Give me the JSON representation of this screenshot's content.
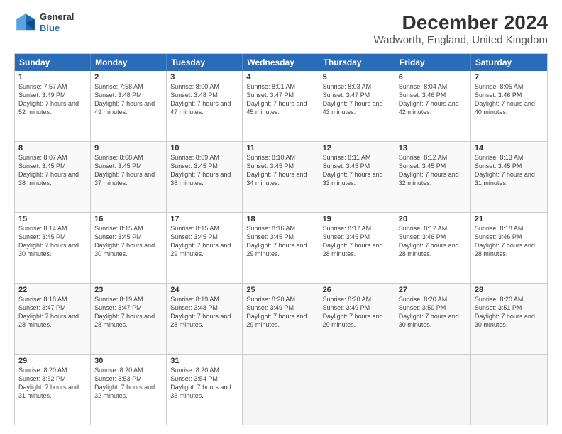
{
  "header": {
    "logo": {
      "line1": "General",
      "line2": "Blue"
    },
    "title": "December 2024",
    "subtitle": "Wadworth, England, United Kingdom"
  },
  "calendar": {
    "days": [
      "Sunday",
      "Monday",
      "Tuesday",
      "Wednesday",
      "Thursday",
      "Friday",
      "Saturday"
    ],
    "weeks": [
      [
        {
          "day": "1",
          "rise": "7:57 AM",
          "set": "3:49 PM",
          "daylight": "7 hours and 52 minutes."
        },
        {
          "day": "2",
          "rise": "7:58 AM",
          "set": "3:48 PM",
          "daylight": "7 hours and 49 minutes."
        },
        {
          "day": "3",
          "rise": "8:00 AM",
          "set": "3:48 PM",
          "daylight": "7 hours and 47 minutes."
        },
        {
          "day": "4",
          "rise": "8:01 AM",
          "set": "3:47 PM",
          "daylight": "7 hours and 45 minutes."
        },
        {
          "day": "5",
          "rise": "8:03 AM",
          "set": "3:47 PM",
          "daylight": "7 hours and 43 minutes."
        },
        {
          "day": "6",
          "rise": "8:04 AM",
          "set": "3:46 PM",
          "daylight": "7 hours and 42 minutes."
        },
        {
          "day": "7",
          "rise": "8:05 AM",
          "set": "3:46 PM",
          "daylight": "7 hours and 40 minutes."
        }
      ],
      [
        {
          "day": "8",
          "rise": "8:07 AM",
          "set": "3:45 PM",
          "daylight": "7 hours and 38 minutes."
        },
        {
          "day": "9",
          "rise": "8:08 AM",
          "set": "3:45 PM",
          "daylight": "7 hours and 37 minutes."
        },
        {
          "day": "10",
          "rise": "8:09 AM",
          "set": "3:45 PM",
          "daylight": "7 hours and 36 minutes."
        },
        {
          "day": "11",
          "rise": "8:10 AM",
          "set": "3:45 PM",
          "daylight": "7 hours and 34 minutes."
        },
        {
          "day": "12",
          "rise": "8:11 AM",
          "set": "3:45 PM",
          "daylight": "7 hours and 33 minutes."
        },
        {
          "day": "13",
          "rise": "8:12 AM",
          "set": "3:45 PM",
          "daylight": "7 hours and 32 minutes."
        },
        {
          "day": "14",
          "rise": "8:13 AM",
          "set": "3:45 PM",
          "daylight": "7 hours and 31 minutes."
        }
      ],
      [
        {
          "day": "15",
          "rise": "8:14 AM",
          "set": "3:45 PM",
          "daylight": "7 hours and 30 minutes."
        },
        {
          "day": "16",
          "rise": "8:15 AM",
          "set": "3:45 PM",
          "daylight": "7 hours and 30 minutes."
        },
        {
          "day": "17",
          "rise": "8:15 AM",
          "set": "3:45 PM",
          "daylight": "7 hours and 29 minutes."
        },
        {
          "day": "18",
          "rise": "8:16 AM",
          "set": "3:45 PM",
          "daylight": "7 hours and 29 minutes."
        },
        {
          "day": "19",
          "rise": "8:17 AM",
          "set": "3:45 PM",
          "daylight": "7 hours and 28 minutes."
        },
        {
          "day": "20",
          "rise": "8:17 AM",
          "set": "3:46 PM",
          "daylight": "7 hours and 28 minutes."
        },
        {
          "day": "21",
          "rise": "8:18 AM",
          "set": "3:46 PM",
          "daylight": "7 hours and 28 minutes."
        }
      ],
      [
        {
          "day": "22",
          "rise": "8:18 AM",
          "set": "3:47 PM",
          "daylight": "7 hours and 28 minutes."
        },
        {
          "day": "23",
          "rise": "8:19 AM",
          "set": "3:47 PM",
          "daylight": "7 hours and 28 minutes."
        },
        {
          "day": "24",
          "rise": "8:19 AM",
          "set": "3:48 PM",
          "daylight": "7 hours and 28 minutes."
        },
        {
          "day": "25",
          "rise": "8:20 AM",
          "set": "3:49 PM",
          "daylight": "7 hours and 29 minutes."
        },
        {
          "day": "26",
          "rise": "8:20 AM",
          "set": "3:49 PM",
          "daylight": "7 hours and 29 minutes."
        },
        {
          "day": "27",
          "rise": "8:20 AM",
          "set": "3:50 PM",
          "daylight": "7 hours and 30 minutes."
        },
        {
          "day": "28",
          "rise": "8:20 AM",
          "set": "3:51 PM",
          "daylight": "7 hours and 30 minutes."
        }
      ],
      [
        {
          "day": "29",
          "rise": "8:20 AM",
          "set": "3:52 PM",
          "daylight": "7 hours and 31 minutes."
        },
        {
          "day": "30",
          "rise": "8:20 AM",
          "set": "3:53 PM",
          "daylight": "7 hours and 32 minutes."
        },
        {
          "day": "31",
          "rise": "8:20 AM",
          "set": "3:54 PM",
          "daylight": "7 hours and 33 minutes."
        },
        null,
        null,
        null,
        null
      ]
    ]
  }
}
